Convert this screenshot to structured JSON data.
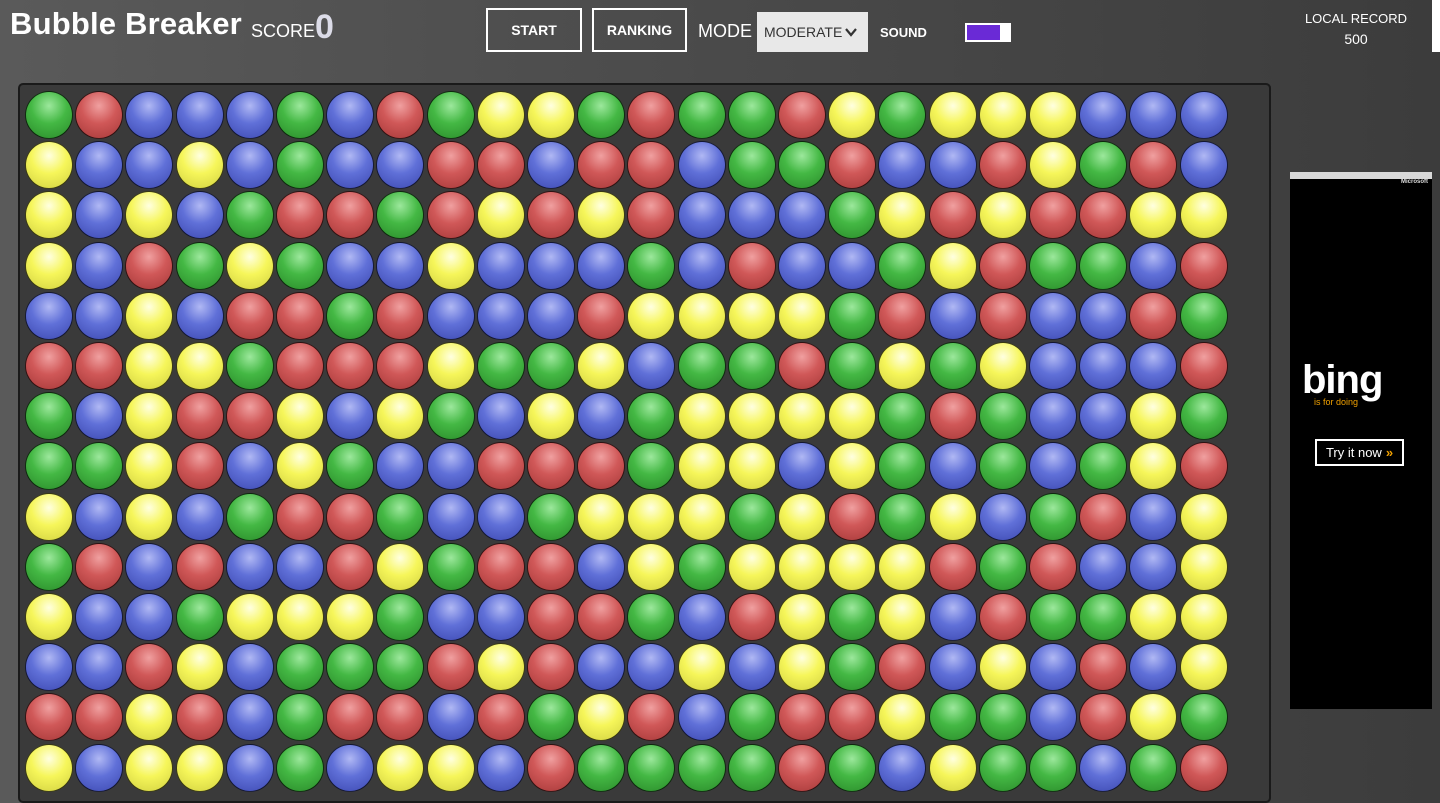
{
  "app": {
    "title": "Bubble Breaker"
  },
  "score": {
    "label": "SCORE",
    "value": "0"
  },
  "toolbar": {
    "start_label": "START",
    "ranking_label": "RANKING",
    "mode_label": "MODE",
    "mode_value": "MODERATE",
    "sound_label": "SOUND",
    "sound_on": true
  },
  "record": {
    "label": "LOCAL RECORD",
    "value": "500"
  },
  "ad": {
    "brand": "bing",
    "tagline": "is for doing",
    "cta_label": "Try it now",
    "cta_chevron": "»",
    "small_label": "Microsoft"
  },
  "colors": {
    "g": "#44b844",
    "r": "#d05858",
    "b": "#6070d8",
    "y": "#f6f65a",
    "sound_toggle": "#6a2ad6"
  },
  "board": {
    "rows": [
      "grbbbgbrgyygrggrygyyybbb",
      "ybbybgbbrrbrrbggrbbrygrb",
      "ybybgrrgryryrbbbgyryrryy",
      "ybrgygbbybbbgbrbbgyrggbr",
      "bbybrrgrbbbryyyygrbrbbrg",
      "rryygrrryggybggrgygybbbr",
      "gbyrrybygbybgyyyygrgbbyg",
      "ggyrbygbbrrrgyybygbgbgyr",
      "ybybgrrgbbgyyygyrgybgrby",
      "grbrbbrygrrbygyyyyrgrbby",
      "ybbgyyygbbrrgbrygybrggyy",
      "bbrybgggryrbbybygrbybrby",
      "rryrbgrrbrgyrbgrryggbryg",
      "ybyybgbyybrggggrgbyggbgr"
    ]
  }
}
